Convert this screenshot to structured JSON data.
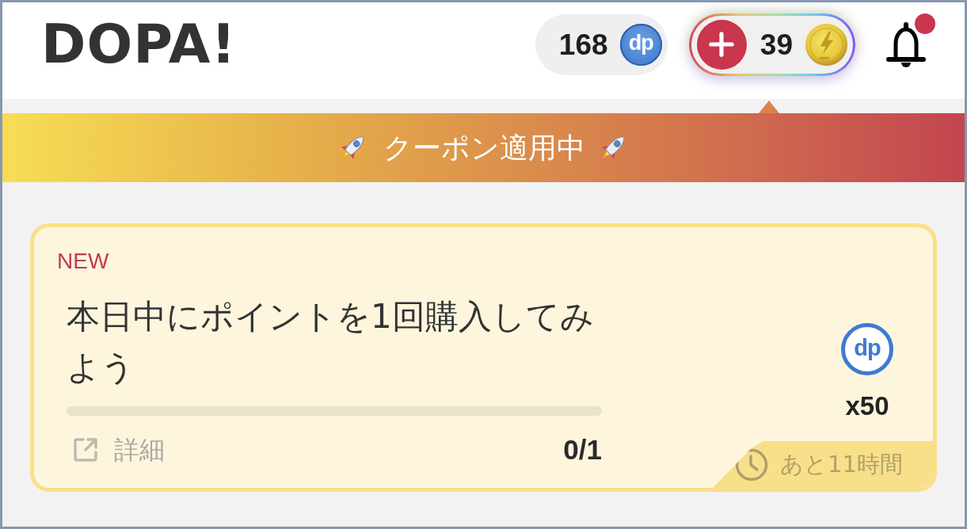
{
  "header": {
    "logo": "DOPA!",
    "points": {
      "value": "168",
      "currency_mark": "dp"
    },
    "coins": {
      "value": "39"
    },
    "notifications": {
      "unread": true
    }
  },
  "banner": {
    "text": "クーポン適用中"
  },
  "missions": [
    {
      "badge": "NEW",
      "title": "本日中にポイントを1回購入してみよう",
      "link": "詳細",
      "progress": "0/1",
      "reward": {
        "currency_mark": "dp",
        "amount": "x50"
      },
      "time_left": "あと11時間"
    }
  ]
}
